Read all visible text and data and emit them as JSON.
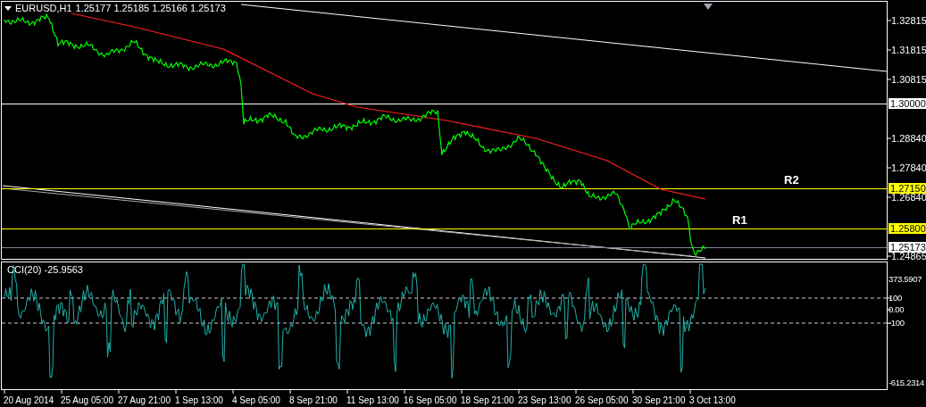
{
  "chart": {
    "symbol": "EURUSD,H1",
    "quote": "1.25177 1.25185 1.25166 1.25173"
  },
  "price_axis": [
    "1.32815",
    "1.31815",
    "1.30815",
    "1.28840",
    "1.27840",
    "1.26840",
    "1.24865"
  ],
  "levels": [
    {
      "kind": "level",
      "price": "1.30000",
      "color": "#ffffff"
    },
    {
      "kind": "level",
      "price": "1.27150",
      "color": "#ffff00",
      "tag": "R2"
    },
    {
      "kind": "level",
      "price": "1.25800",
      "color": "#ffff00",
      "tag": "R1"
    },
    {
      "kind": "bid",
      "price": "1.25173",
      "color": "#778899"
    }
  ],
  "indicator": {
    "title": "CCI(20) -25.9563",
    "axis": [
      "373.5907",
      "100",
      "0.00",
      "-100",
      "-615.2314"
    ]
  },
  "time_axis": [
    "20 Aug 2014",
    "25 Aug 05:00",
    "27 Aug 21:00",
    "1 Sep 13:00",
    "4 Sep 05:00",
    "8 Sep 21:00",
    "11 Sep 13:00",
    "16 Sep 05:00",
    "18 Sep 21:00",
    "23 Sep 13:00",
    "26 Sep 05:00",
    "30 Sep 21:00",
    "3 Oct 13:00"
  ]
}
